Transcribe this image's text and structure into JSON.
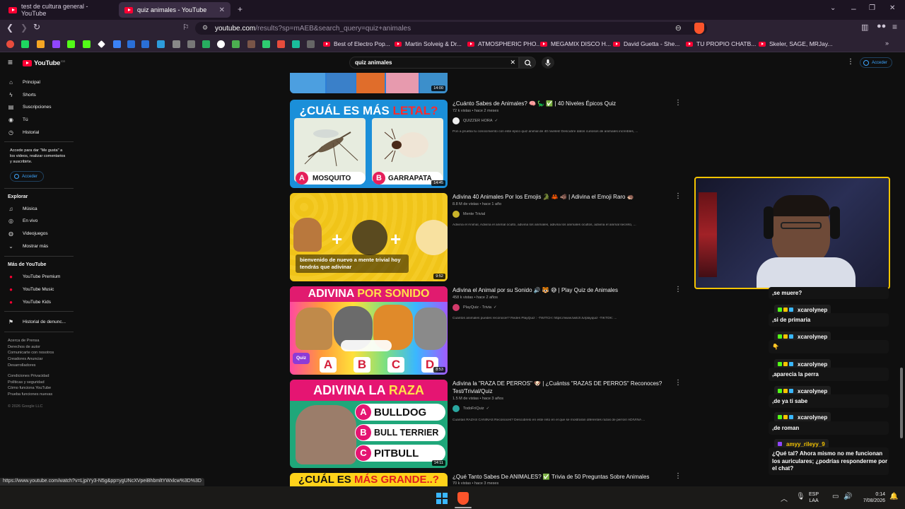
{
  "browser": {
    "tabs": [
      {
        "title": "test de cultura general - YouTube"
      },
      {
        "title": "quiz animales - YouTube"
      }
    ],
    "url_domain": "youtube.com",
    "url_path": "/results?sp=mAEB&search_query=quiz+animales",
    "bookmarks": [
      "Best of Electro Pop...",
      "Martin Solveig & Dr...",
      "ATMOSPHERIC PHO...",
      "MEGAMIX DISCO H...",
      "David Guetta - She...",
      "TU PROPIO CHATB...",
      "Skeler, SAGE, MRJay..."
    ],
    "status_url": "https://www.youtube.com/watch?v=LjpiYy3-N5g&pp=ygUNcXVpeiBhbmltYWxlcw%3D%3D"
  },
  "youtube": {
    "logo": "YouTube",
    "logo_region": "CO",
    "search_query": "quiz animales",
    "signin_label": "Acceder",
    "sidebar": {
      "main": [
        "Principal",
        "Shorts",
        "Suscripciones",
        "Tú",
        "Historial"
      ],
      "signin_prompt": "Accede para dar \"Me gusta\" a los videos, realizar comentarios y suscribirte.",
      "signin_button": "Acceder",
      "explore_title": "Explorar",
      "explore": [
        "Música",
        "En vivo",
        "Videojuegos",
        "Mostrar más"
      ],
      "more_title": "Más de YouTube",
      "more": [
        "YouTube Premium",
        "YouTube Music",
        "YouTube Kids"
      ],
      "report": "Historial de denunc...",
      "footer1": [
        "Acerca de  Prensa",
        "Derechos de autor",
        "Comunicarte con nosotros",
        "Creadores  Anunciar",
        "Desarrolladores"
      ],
      "footer2": [
        "Condiciones  Privacidad",
        "Políticas y seguridad",
        "Cómo funciona YouTube",
        "Prueba funciones nuevas"
      ],
      "copyright": "© 2026 Google LLC"
    },
    "results": [
      {
        "duration": "14:00"
      },
      {
        "title": "¿Cuánto Sabes de Animales? 🧠 🦕 ✅ | 40 Niveles Épicos Quiz",
        "meta": "72 k vistas  •  hace 2 meses",
        "channel": "QUIZZER HORA",
        "desc": "Pon a prueba tu conocimiento con este épico quiz animal de 40 niveles! Descubre datos curiosos de animales increíbles, ...",
        "thumb_title_1": "¿CUÁL ES MÁS ",
        "thumb_title_2": "LETAL?",
        "opt_a": "MOSQUITO",
        "opt_b": "GARRAPATA",
        "duration": "14:45"
      },
      {
        "title": "Adivina 40 Animales Por los Emojis 🐊 🦀 🐗 | Adivina el Emoji Raro 🦔",
        "meta": "8.8 M de vistas  •  hace 1 año",
        "channel": "Mente Trivial",
        "desc": "Adivina el Animal, Adivina el animal oculto, adivina los animales, adivina los animales ocultos, adivina el animal secreto, ...",
        "caption": "bienvenido de nuevo a mente trivial hoy tendrás que adivinar",
        "duration": "9:52"
      },
      {
        "title": "Adivina el Animal por su Sonido 🔊 🐯 😅 | Play Quiz de Animales",
        "meta": "458 k vistas  •  hace 2 años",
        "channel": "PlayQuiz - Trivia",
        "desc": "Cuántos animales puedes reconocer? Redes PlayQuiz : -TWITCH: https://www.twitch.tv/playquiz -TIKTOK: ...",
        "thumb_title_1": "ADIVINA ",
        "thumb_title_2": "POR SONIDO",
        "letters": [
          "A",
          "B",
          "C",
          "D"
        ],
        "badge": "Quiz",
        "duration": "8:53"
      },
      {
        "title": "Adivina la \"RAZA DE PERROS\" 🐶 | ¿Cuántss \"RAZAS DE PERROS\" Reconoces? Test/Trivial/Quiz",
        "meta": "1.5 M de vistas  •  hace 3 años",
        "channel": "TodoFriQuiz",
        "desc": "Cuántas RAZAS CANINAS Reconoces? Descúbrelo en este reto en el que se mostrarán diferentes razas de perros! ADIVINA ...",
        "thumb_title_1": "ADIVINA LA ",
        "thumb_title_2": "RAZA",
        "opts": [
          {
            "letter": "A",
            "text": "BULLDOG"
          },
          {
            "letter": "B",
            "text": "BULL TERRIER"
          },
          {
            "letter": "C",
            "text": "PITBULL"
          }
        ],
        "duration": "14:11"
      },
      {
        "title": "¿Qué Tanto Sabes De ANIMALES? ✅ Trivia de 50 Preguntas Sobre Animales",
        "meta": "70 k vistas  •  hace 3 meses",
        "thumb_title_1": "¿CUÁL ES ",
        "thumb_title_2": "MÁS GRANDE..?"
      }
    ]
  },
  "chat": {
    "messages": [
      {
        "type": "msg",
        "text": ",se muere?"
      },
      {
        "type": "user",
        "text": "xcarolynep"
      },
      {
        "type": "msg",
        "text": ",si de primaria"
      },
      {
        "type": "user",
        "text": "xcarolynep"
      },
      {
        "type": "msg",
        "text": "👇"
      },
      {
        "type": "user",
        "text": "xcarolynep"
      },
      {
        "type": "msg",
        "text": ",aparecia la perra"
      },
      {
        "type": "user",
        "text": "xcarolynep"
      },
      {
        "type": "msg",
        "text": ",de ya ti sabe"
      },
      {
        "type": "user",
        "text": "xcarolynep"
      },
      {
        "type": "msg",
        "text": ",de roman"
      },
      {
        "type": "user2",
        "text": "amyy_rileyy_9"
      },
      {
        "type": "long",
        "text": "¿Qué tal? Ahora mismo no me funcionan los auriculares; ¿podrías responderme por el chat?"
      }
    ]
  },
  "taskbar": {
    "lang1": "ESP",
    "lang2": "LAA",
    "time": "0:14",
    "date": "7/08/2026"
  },
  "colors": {
    "accent_yellow": "#f5c400",
    "youtube_red": "#ff0033",
    "browser_bg": "#2c2233"
  }
}
